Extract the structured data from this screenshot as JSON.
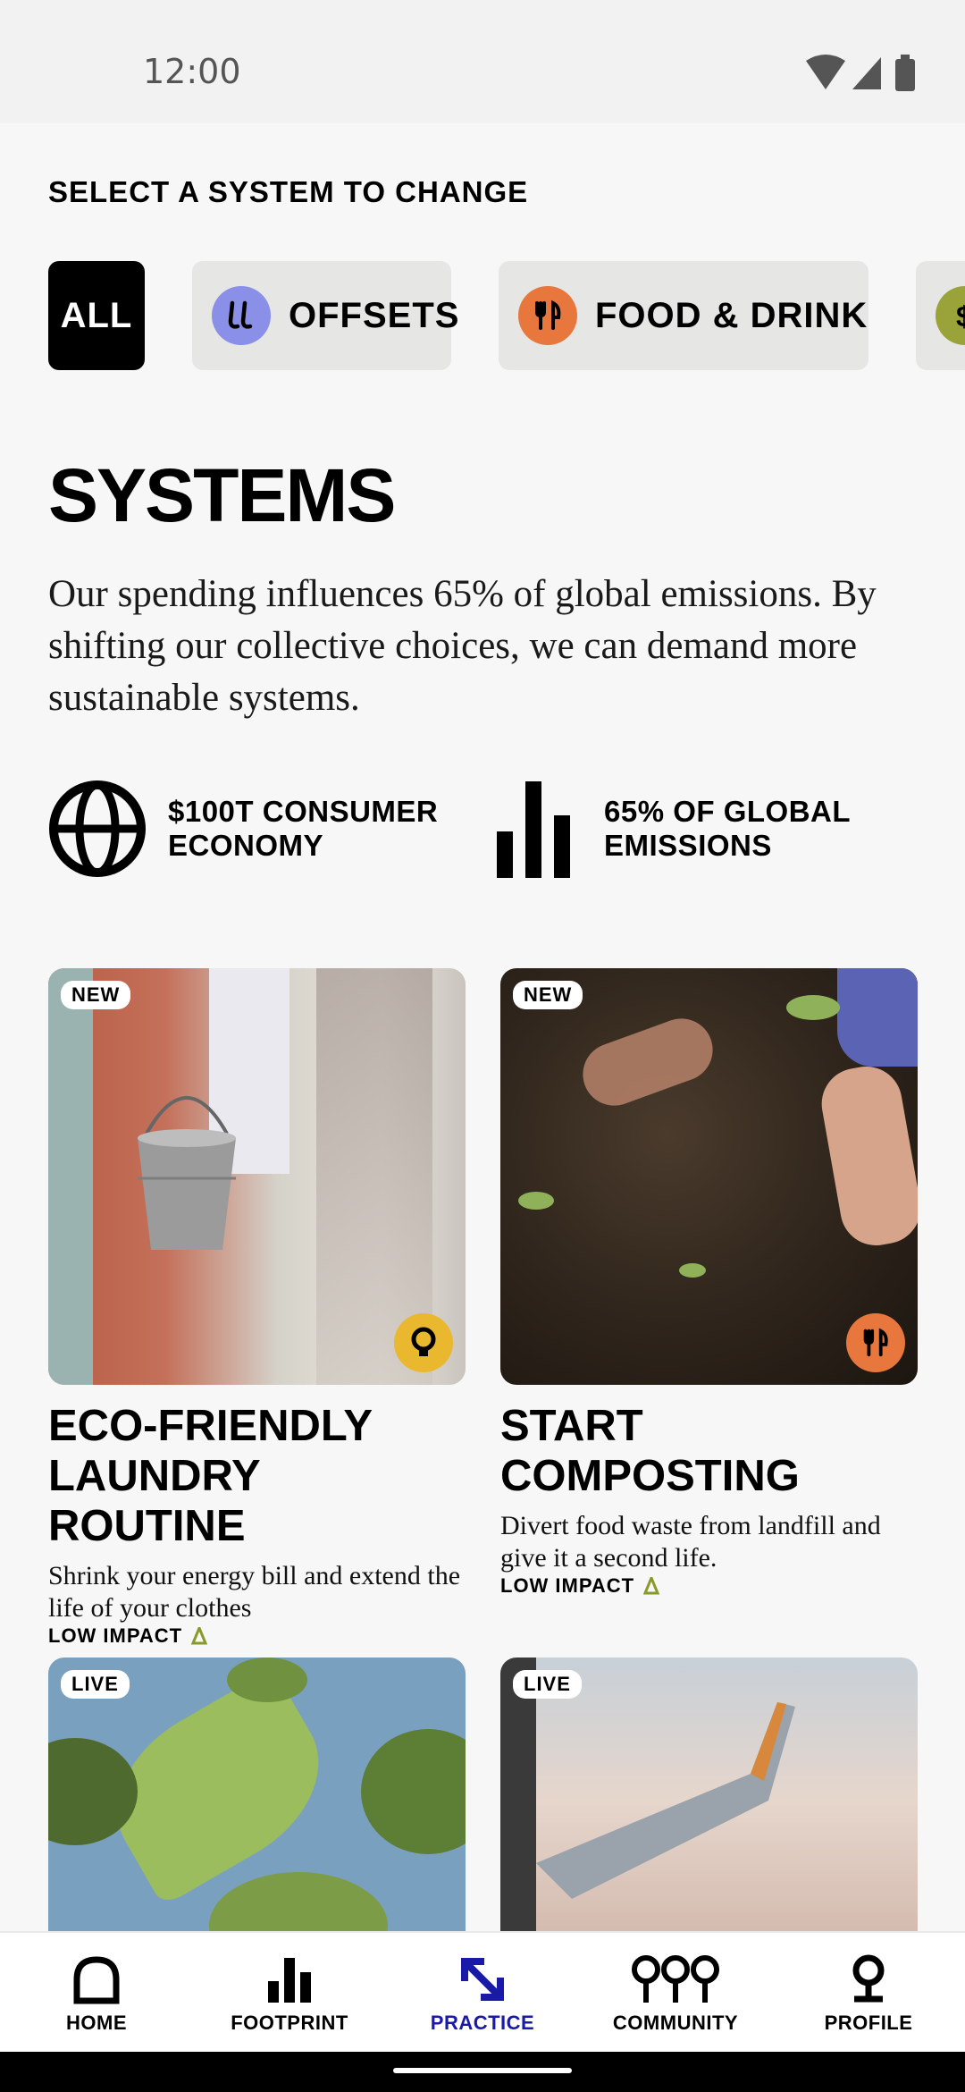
{
  "status_bar": {
    "time": "12:00"
  },
  "section_label": "SELECT A SYSTEM TO CHANGE",
  "chips": [
    {
      "label": "ALL",
      "active": true
    },
    {
      "label": "OFFSETS",
      "icon": "offsets-icon",
      "color": "#8a8fe8"
    },
    {
      "label": "FOOD & DRINK",
      "icon": "fork-knife-icon",
      "color": "#e8773e"
    },
    {
      "label": "",
      "icon": "dollar-icon",
      "color": "#9aa33a"
    }
  ],
  "page_title": "SYSTEMS",
  "intro": "Our spending influences 65% of global emissions. By shifting our collective choices, we can demand more sustainable systems.",
  "stats": [
    {
      "icon": "globe-icon",
      "line1": "$100T CONSUMER",
      "line2": "ECONOMY"
    },
    {
      "icon": "bar-chart-icon",
      "line1": "65% OF GLOBAL",
      "line2": "EMISSIONS"
    }
  ],
  "cards": [
    {
      "badge": "NEW",
      "title_line1": "ECO-FRIENDLY",
      "title_line2": "LAUNDRY ROUTINE",
      "description": "Shrink your energy bill and extend the life of your clothes",
      "impact": "LOW IMPACT",
      "category_icon": "lightbulb-icon",
      "category_color": "#e9b82e"
    },
    {
      "badge": "NEW",
      "title_line1": "START",
      "title_line2": "COMPOSTING",
      "description": "Divert food waste from landfill and give it a second life.",
      "impact": "LOW IMPACT",
      "category_icon": "fork-knife-icon",
      "category_color": "#e8773e"
    },
    {
      "badge": "LIVE"
    },
    {
      "badge": "LIVE"
    }
  ],
  "nav": [
    {
      "label": "HOME",
      "icon": "home-icon"
    },
    {
      "label": "FOOTPRINT",
      "icon": "footprint-icon"
    },
    {
      "label": "PRACTICE",
      "icon": "practice-icon",
      "active": true
    },
    {
      "label": "COMMUNITY",
      "icon": "community-icon"
    },
    {
      "label": "PROFILE",
      "icon": "profile-icon"
    }
  ],
  "colors": {
    "accent_nav": "#1a1aa8",
    "impact_green": "#8a9a2a"
  }
}
